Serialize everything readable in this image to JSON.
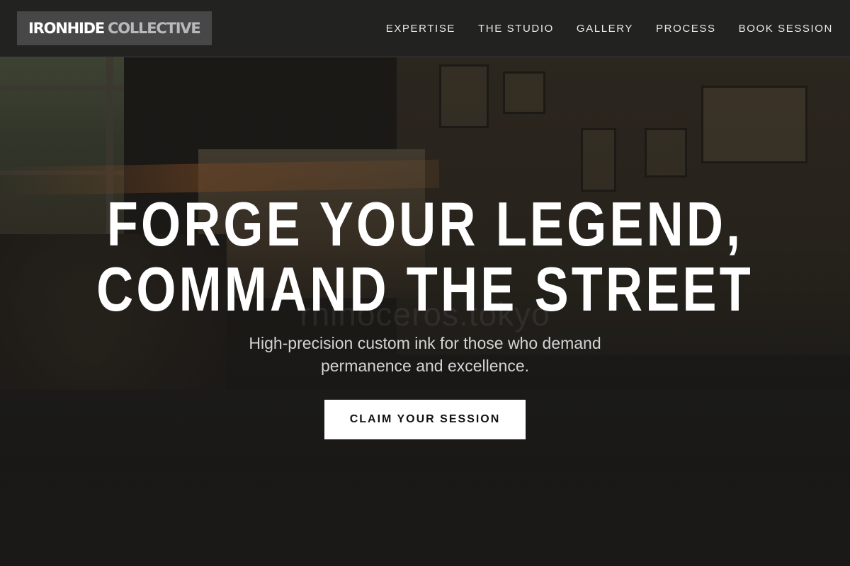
{
  "brand": {
    "name_part1": "IRONHIDE",
    "name_part2": "COLLECTIVE"
  },
  "nav": {
    "items": [
      {
        "label": "EXPERTISE"
      },
      {
        "label": "THE STUDIO"
      },
      {
        "label": "GALLERY"
      },
      {
        "label": "PROCESS"
      },
      {
        "label": "BOOK SESSION"
      }
    ]
  },
  "hero": {
    "headline_line1": "FORGE YOUR LEGEND,",
    "headline_line2": "COMMAND THE STREET",
    "watermark": "rhinoceros.tokyo",
    "subtitle": "High-precision custom ink for those who demand permanence and excellence.",
    "cta_label": "CLAIM YOUR SESSION"
  },
  "colors": {
    "nav_bg": "#222221",
    "logo_bg": "#474747",
    "logo_accent": "#b7b9bc",
    "cta_bg": "#ffffff",
    "cta_text": "#111111"
  }
}
